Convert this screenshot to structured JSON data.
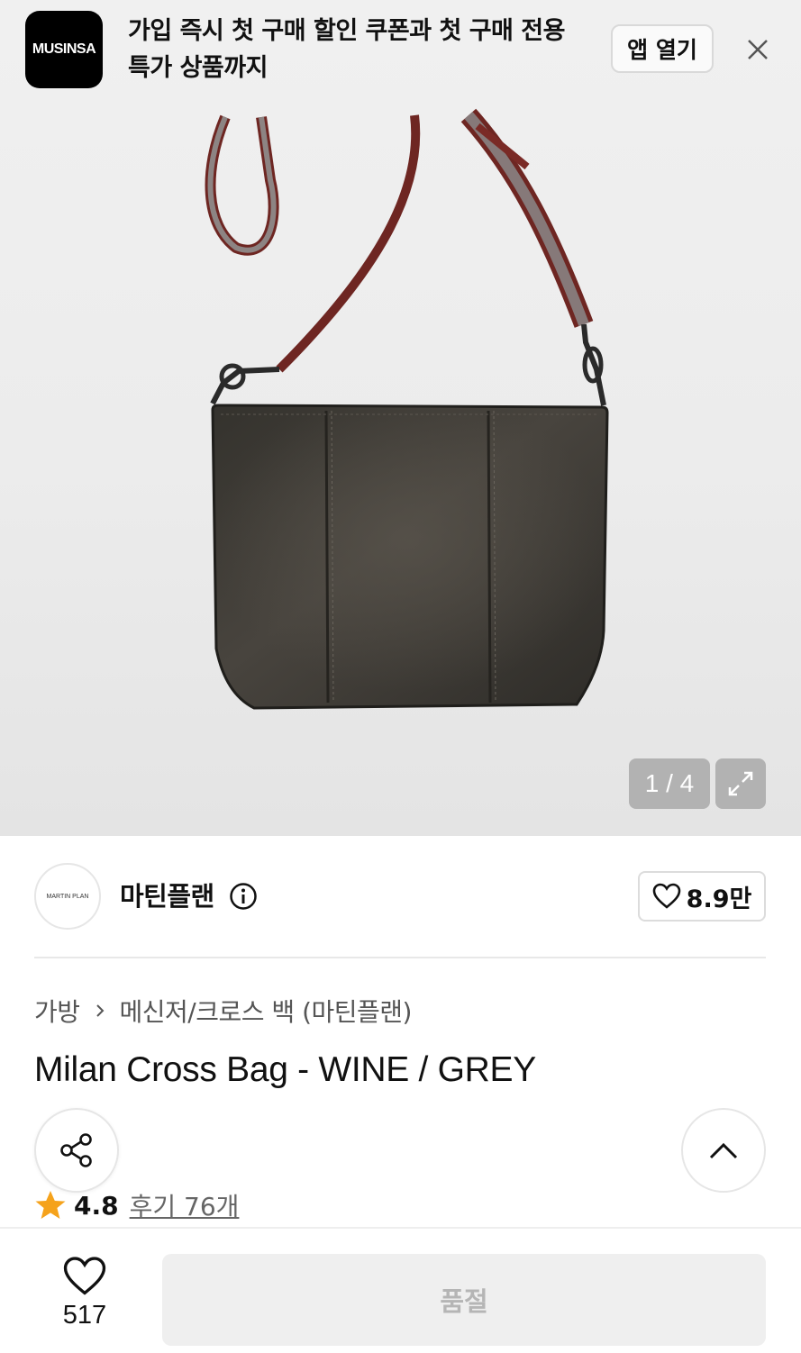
{
  "banner": {
    "logo_text": "MUSINSA",
    "message": "가입 즉시 첫 구매 할인 쿠폰과 첫 구매 전용 특가 상품까지",
    "open_app_label": "앱 열기",
    "close_icon": "close-icon"
  },
  "gallery": {
    "counter": "1 / 4",
    "expand_icon": "expand-icon"
  },
  "brand": {
    "avatar_text": "MARTIN PLAN",
    "name": "마틴플랜",
    "info_icon": "info-icon",
    "like_count": "8.9만"
  },
  "breadcrumb": {
    "category": "가방",
    "subcategory": "메신저/크로스 백 (마틴플랜)"
  },
  "product": {
    "title": "Milan Cross Bag - WINE / GREY",
    "rating": "4.8",
    "reviews": "후기 76개"
  },
  "bottom_bar": {
    "wish_count": "517",
    "buy_label": "품절"
  },
  "colors": {
    "star": "#f5a21b",
    "bag_body": "#3b3833",
    "strap": "#7a2a26"
  }
}
